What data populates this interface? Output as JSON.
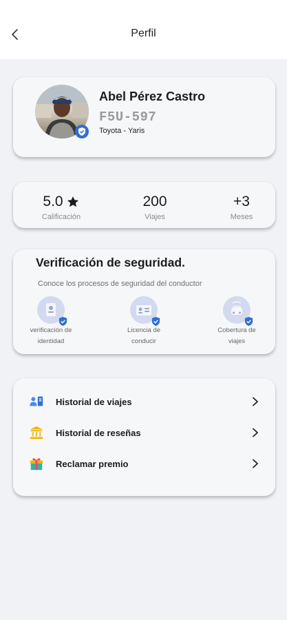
{
  "header": {
    "title": "Perfil",
    "back_icon": "chevron-left-icon"
  },
  "profile": {
    "name": "Abel Pérez Castro",
    "plate": "F5U-597",
    "car": "Toyota - Yaris",
    "badge_icon": "verified-shield-icon"
  },
  "stats": [
    {
      "value": "5.0",
      "label": "Calificación",
      "icon": "star-icon"
    },
    {
      "value": "200",
      "label": "Viajes"
    },
    {
      "value": "+3",
      "label": "Meses"
    }
  ],
  "security": {
    "title": "Verificación de seguridad.",
    "subtitle": "Conoce los procesos de seguridad del conductor",
    "items": [
      {
        "line1": "verificación de",
        "line2": "identidad",
        "icon": "id-card-icon"
      },
      {
        "line1": "Licencia de",
        "line2": "conducir",
        "icon": "license-icon"
      },
      {
        "line1": "Cobertura de",
        "line2": "viajes",
        "icon": "car-coverage-icon"
      }
    ]
  },
  "menu": [
    {
      "label": "Historial de viajes",
      "icon": "users-icon"
    },
    {
      "label": "Historial de reseñas",
      "icon": "bank-icon"
    },
    {
      "label": "Reclamar premio",
      "icon": "gift-icon"
    }
  ],
  "colors": {
    "accent": "#2f6fd1",
    "icon_bg": "#d3d9ef",
    "background": "#f1f2f5"
  }
}
